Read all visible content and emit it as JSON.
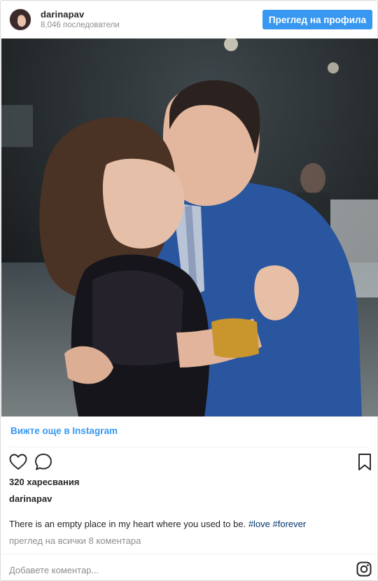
{
  "header": {
    "username": "darinapav",
    "followers": "8,046 последователи",
    "view_profile_label": "Преглед на профила"
  },
  "post": {
    "view_more_label": "Вижте още в Instagram",
    "likes": "320 харесвания",
    "caption_user": "darinapav",
    "caption_text": "There is an empty place in my heart where you used to be.",
    "hashtags": [
      "#love",
      "#forever"
    ],
    "view_comments": "преглед на всички 8 коментара",
    "comment_placeholder": "Добавете коментар..."
  },
  "icons": {
    "like": "heart-icon",
    "comment": "comment-bubble-icon",
    "save": "bookmark-icon",
    "brand": "instagram-logo-icon"
  },
  "colors": {
    "accent": "#3897f0",
    "hashtag": "#003569",
    "muted": "#8e8e8e",
    "text": "#262626"
  }
}
